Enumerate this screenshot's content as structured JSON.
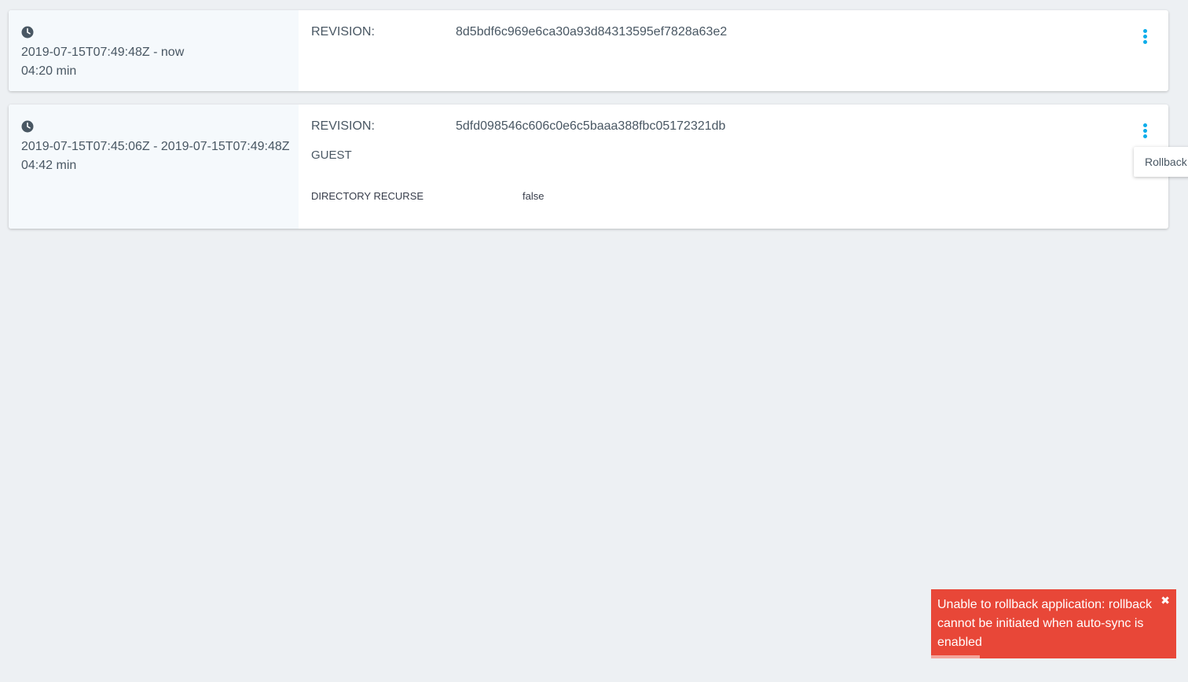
{
  "history": [
    {
      "time_range": "2019-07-15T07:49:48Z - now",
      "duration": "04:20 min",
      "revision_label": "REVISION:",
      "revision": "8d5bdf6c969e6ca30a93d84313595ef7828a63e2"
    },
    {
      "time_range": "2019-07-15T07:45:06Z - 2019-07-15T07:49:48Z",
      "duration": "04:42 min",
      "revision_label": "REVISION:",
      "revision": "5dfd098546c606c0e6c5baaa388fbc05172321db",
      "section": "GUEST",
      "param_name": "DIRECTORY RECURSE",
      "param_value": "false"
    }
  ],
  "menu": {
    "rollback_label": "Rollback"
  },
  "toast": {
    "message": "Unable to rollback application: rollback cannot be initiated when auto-sync is enabled",
    "close_icon": "✖",
    "progress": 0.2
  },
  "colors": {
    "accent": "#0dadea",
    "error": "#e84738",
    "text": "#495763",
    "background": "#edf0f3"
  }
}
